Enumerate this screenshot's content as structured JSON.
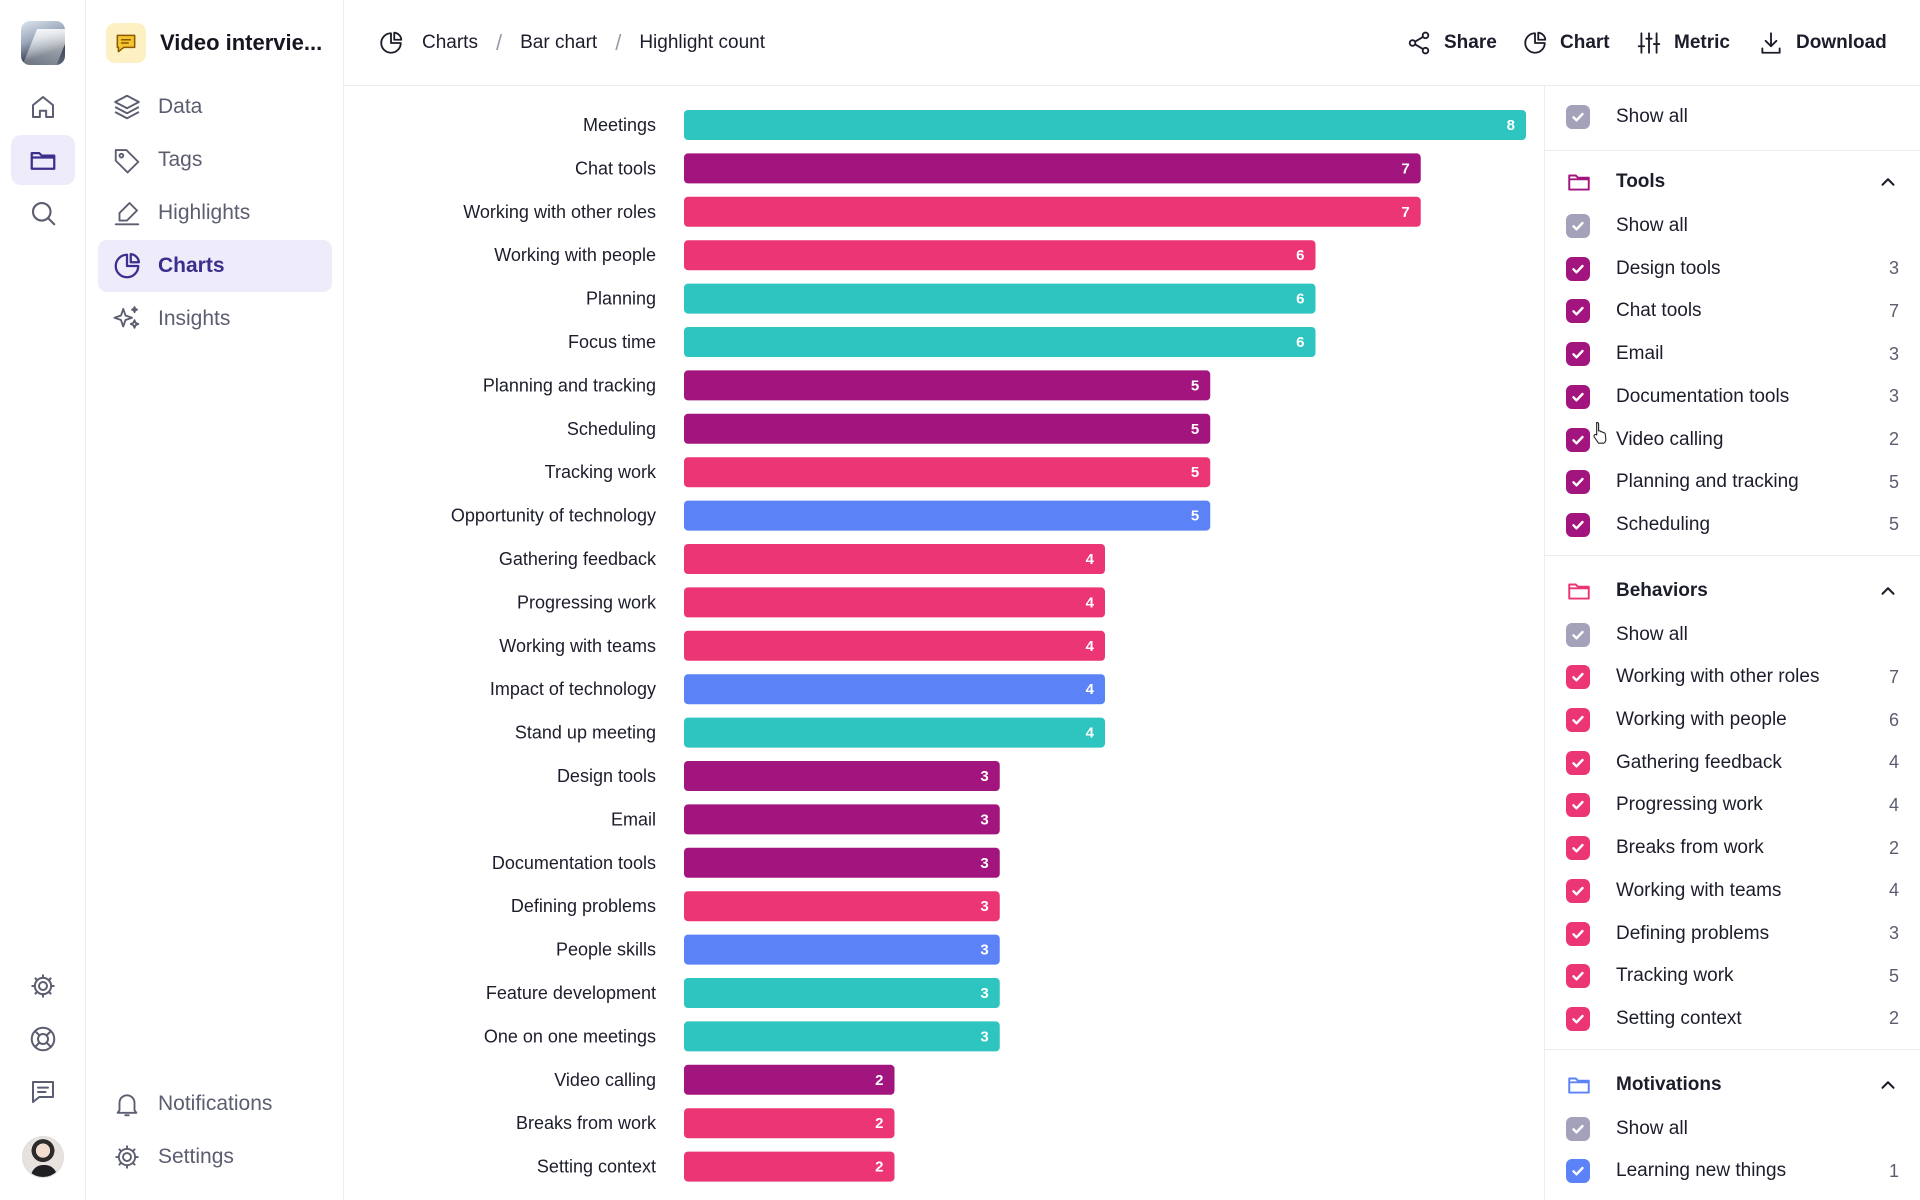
{
  "workspace": {
    "name": "Video intervie..."
  },
  "rail": {
    "items": [
      {
        "name": "home-icon",
        "active": false
      },
      {
        "name": "folder-icon",
        "active": true
      },
      {
        "name": "search-icon",
        "active": false
      }
    ],
    "bottom": [
      "gear-icon",
      "lifebuoy-icon",
      "chat-icon"
    ]
  },
  "nav": {
    "items": [
      {
        "label": "Data",
        "icon": "layers-icon"
      },
      {
        "label": "Tags",
        "icon": "tag-icon"
      },
      {
        "label": "Highlights",
        "icon": "highlighter-icon"
      },
      {
        "label": "Charts",
        "icon": "pie-chart-icon"
      },
      {
        "label": "Insights",
        "icon": "sparkle-icon"
      }
    ],
    "notifications_label": "Notifications",
    "settings_label": "Settings"
  },
  "breadcrumb": [
    "Charts",
    "Bar chart",
    "Highlight count"
  ],
  "toolbar": {
    "share_label": "Share",
    "chart_label": "Chart",
    "metric_label": "Metric",
    "download_label": "Download"
  },
  "colors": {
    "teal": "#2ec5c0",
    "purple": "#a3157e",
    "pink": "#ec3574",
    "blue": "#5b82f6",
    "accent": "#3b2f8e",
    "checkbox_gray": "#a4a2ba"
  },
  "chart_data": {
    "type": "bar",
    "orientation": "horizontal",
    "title": "Highlight count",
    "xlim": [
      0,
      8
    ],
    "categories": [
      "Meetings",
      "Chat tools",
      "Working with other roles",
      "Working with people",
      "Planning",
      "Focus time",
      "Planning and tracking",
      "Scheduling",
      "Tracking work",
      "Opportunity of technology",
      "Gathering feedback",
      "Progressing work",
      "Working with teams",
      "Impact of technology",
      "Stand up meeting",
      "Design tools",
      "Email",
      "Documentation tools",
      "Defining problems",
      "People skills",
      "Feature development",
      "One on one meetings",
      "Video calling",
      "Breaks from work",
      "Setting context"
    ],
    "values": [
      8,
      7,
      7,
      6,
      6,
      6,
      5,
      5,
      5,
      5,
      4,
      4,
      4,
      4,
      4,
      3,
      3,
      3,
      3,
      3,
      3,
      3,
      2,
      2,
      2
    ],
    "groups": [
      "teal",
      "purple",
      "pink",
      "pink",
      "teal",
      "teal",
      "purple",
      "purple",
      "pink",
      "blue",
      "pink",
      "pink",
      "pink",
      "blue",
      "teal",
      "purple",
      "purple",
      "purple",
      "pink",
      "blue",
      "teal",
      "teal",
      "purple",
      "pink",
      "pink"
    ]
  },
  "filters": {
    "show_all_label": "Show all",
    "groups": [
      {
        "title": "Tools",
        "color": "purple",
        "items": [
          {
            "label": "Design tools",
            "count": "3"
          },
          {
            "label": "Chat tools",
            "count": "7"
          },
          {
            "label": "Email",
            "count": "3"
          },
          {
            "label": "Documentation tools",
            "count": "3"
          },
          {
            "label": "Video calling",
            "count": "2"
          },
          {
            "label": "Planning and tracking",
            "count": "5"
          },
          {
            "label": "Scheduling",
            "count": "5"
          }
        ]
      },
      {
        "title": "Behaviors",
        "color": "pink",
        "items": [
          {
            "label": "Working with other roles",
            "count": "7"
          },
          {
            "label": "Working with people",
            "count": "6"
          },
          {
            "label": "Gathering feedback",
            "count": "4"
          },
          {
            "label": "Progressing work",
            "count": "4"
          },
          {
            "label": "Breaks from work",
            "count": "2"
          },
          {
            "label": "Working with teams",
            "count": "4"
          },
          {
            "label": "Defining problems",
            "count": "3"
          },
          {
            "label": "Tracking work",
            "count": "5"
          },
          {
            "label": "Setting context",
            "count": "2"
          }
        ]
      },
      {
        "title": "Motivations",
        "color": "blue",
        "items": [
          {
            "label": "Learning new things",
            "count": "1"
          }
        ]
      }
    ]
  }
}
